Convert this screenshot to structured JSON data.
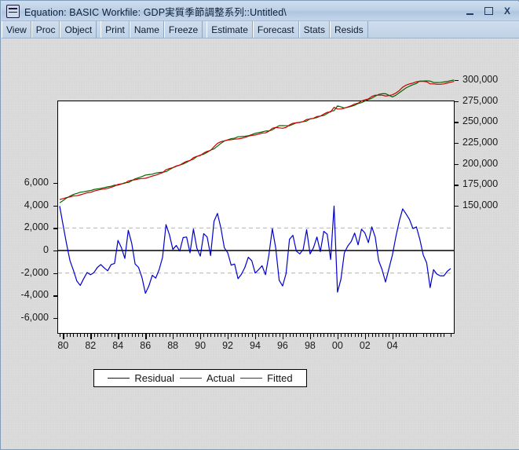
{
  "window": {
    "title": "Equation: BASIC   Workfile: GDP実質季節調整系列::Untitled\\",
    "icon": "equation-window-icon",
    "buttons": {
      "minimize": "minimize-icon",
      "maximize": "maximize-icon",
      "close": "X"
    }
  },
  "toolbar": {
    "groups": [
      {
        "items": [
          "View",
          "Proc",
          "Object"
        ]
      },
      {
        "items": [
          "Print",
          "Name",
          "Freeze"
        ]
      },
      {
        "items": [
          "Estimate",
          "Forecast",
          "Stats",
          "Resids"
        ]
      }
    ]
  },
  "colors": {
    "residual": "#0000cc",
    "actual": "#cc0000",
    "fitted": "#006600",
    "zero_line": "#000000",
    "grid_dashed": "#bbbbbb",
    "plot_background": "#ffffff",
    "window_background": "#d9d9d9",
    "titlebar": "#bdd0e6"
  },
  "chart_data": {
    "type": "line",
    "title": "",
    "xlabel": "",
    "grid": "dashed horizontal gridlines at +2,000 and -2,000 on left axis",
    "legend_position": "bottom-center",
    "x_axis": {
      "ticks": [
        "80",
        "82",
        "84",
        "86",
        "88",
        "90",
        "92",
        "94",
        "96",
        "98",
        "00",
        "02",
        "04"
      ],
      "minor_ticks_per_major": 8,
      "range": [
        "1979Q4",
        "2005Q2"
      ],
      "frequency": "quarterly"
    },
    "left_axis": {
      "label": "",
      "ticks": [
        "6,000",
        "4,000",
        "2,000",
        "0",
        "-2,000",
        "-4,000",
        "-6,000"
      ],
      "ylim": [
        -6000,
        6000
      ],
      "series": "Residual"
    },
    "right_axis": {
      "label": "",
      "ticks": [
        "300,000",
        "275,000",
        "250,000",
        "225,000",
        "200,000",
        "175,000",
        "150,000"
      ],
      "ylim": [
        150000,
        300000
      ],
      "series": "Actual, Fitted"
    },
    "series": [
      {
        "name": "Residual",
        "color": "#0000cc",
        "axis": "left",
        "values": [
          3950,
          2250,
          600,
          -900,
          -1750,
          -2700,
          -3100,
          -2500,
          -1950,
          -2150,
          -1950,
          -1500,
          -1250,
          -1550,
          -1800,
          -1250,
          -1150,
          900,
          250,
          -700,
          1800,
          650,
          -1200,
          -1500,
          -2400,
          -3800,
          -3150,
          -2200,
          -2450,
          -1700,
          -600,
          2300,
          1400,
          100,
          450,
          -50,
          1150,
          1200,
          -200,
          1900,
          200,
          -500,
          1500,
          1200,
          -450,
          2600,
          3300,
          2000,
          250,
          -200,
          -1300,
          -1200,
          -2500,
          -2100,
          -1500,
          -600,
          -900,
          -2000,
          -1700,
          -1350,
          -2150,
          -400,
          1950,
          200,
          -2650,
          -3150,
          -2050,
          1000,
          1350,
          -50,
          -300,
          100,
          1850,
          -300,
          250,
          1200,
          -100,
          1700,
          1450,
          -800,
          3950,
          -3700,
          -2550,
          -200,
          400,
          800,
          1550,
          500,
          1900,
          1550,
          700,
          2100,
          1200,
          -900,
          -1700,
          -2800,
          -1600,
          -400,
          1200,
          2600,
          3700,
          3250,
          2750,
          1950,
          2100,
          1000,
          -400,
          -1100,
          -3300,
          -1700,
          -2100,
          -2250,
          -2250,
          -1850,
          -1600
        ]
      },
      {
        "name": "Actual",
        "color": "#cc0000",
        "axis": "right",
        "values": [
          157500,
          158500,
          159800,
          160500,
          161800,
          162000,
          163000,
          164200,
          165500,
          166000,
          167500,
          168600,
          169500,
          170000,
          170800,
          172000,
          173500,
          175500,
          176200,
          176800,
          179500,
          180500,
          181000,
          182000,
          182500,
          182800,
          184000,
          185500,
          186500,
          188000,
          189500,
          193000,
          194500,
          195500,
          197500,
          198500,
          201000,
          203000,
          204000,
          207500,
          209000,
          210000,
          213000,
          215000,
          216000,
          220500,
          224500,
          226500,
          227500,
          228500,
          228800,
          229500,
          229800,
          230500,
          231500,
          233000,
          234000,
          234500,
          235500,
          236800,
          237000,
          239000,
          242500,
          243500,
          243000,
          242500,
          243500,
          246500,
          248500,
          249000,
          249500,
          250500,
          253000,
          253500,
          254500,
          256500,
          257000,
          259500,
          261500,
          262000,
          267500,
          265500,
          265500,
          266500,
          268000,
          269500,
          271500,
          272500,
          275000,
          276500,
          277500,
          280500,
          282000,
          282000,
          282000,
          281000,
          281500,
          282500,
          284500,
          287500,
          291500,
          294000,
          295500,
          296500,
          298000,
          298500,
          298500,
          298000,
          295500,
          295500,
          295000,
          295000,
          295500,
          296500,
          297500,
          298500
        ]
      },
      {
        "name": "Fitted",
        "color": "#006600",
        "axis": "right",
        "values": [
          153550,
          156250,
          159200,
          161400,
          163550,
          164700,
          166100,
          166700,
          167450,
          168150,
          169450,
          170100,
          170750,
          171550,
          172600,
          173250,
          174650,
          174600,
          175950,
          177500,
          177700,
          179850,
          182200,
          183500,
          184900,
          186600,
          187150,
          187700,
          188950,
          189700,
          190100,
          190700,
          193100,
          195400,
          197050,
          198550,
          199850,
          201800,
          204200,
          205600,
          208800,
          210500,
          211500,
          213800,
          216450,
          217900,
          221200,
          224500,
          227250,
          228700,
          230100,
          230700,
          232300,
          232600,
          233000,
          233600,
          234900,
          236500,
          237200,
          238150,
          239150,
          239400,
          240550,
          243300,
          245650,
          245650,
          245550,
          245500,
          247150,
          249050,
          249800,
          250400,
          251150,
          253800,
          254250,
          255300,
          257100,
          257800,
          260050,
          262800,
          263550,
          269200,
          268050,
          266700,
          267600,
          268700,
          269950,
          272000,
          273100,
          274950,
          276800,
          278400,
          280800,
          282900,
          283700,
          283800,
          281900,
          279900,
          281900,
          284900,
          287800,
          290750,
          292750,
          294550,
          296000,
          298900,
          298900,
          299100,
          298800,
          297200,
          297100,
          297250,
          297750,
          298350,
          299350,
          300100
        ]
      }
    ]
  },
  "legend": {
    "items": [
      {
        "label": "Residual",
        "color": "#0000cc"
      },
      {
        "label": "Actual",
        "color": "#cc0000"
      },
      {
        "label": "Fitted",
        "color": "#006600"
      }
    ]
  }
}
